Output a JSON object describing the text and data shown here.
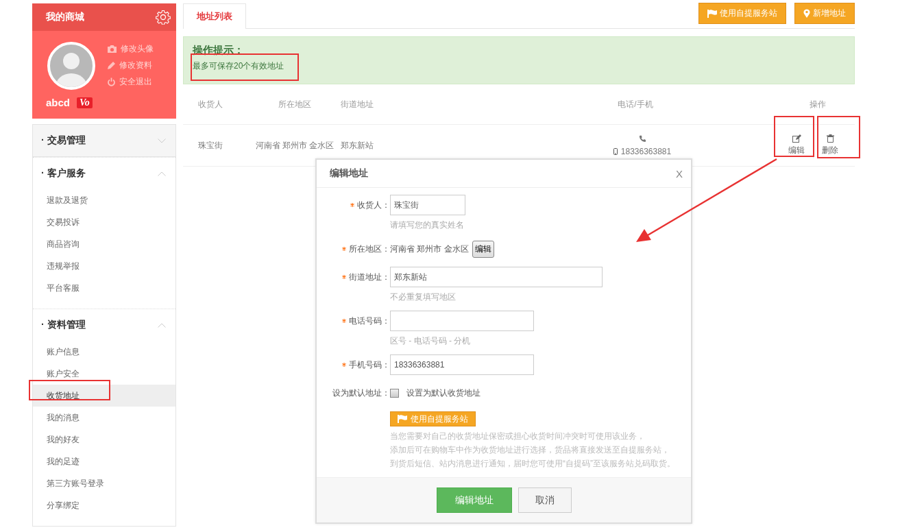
{
  "sidebar": {
    "title": "我的商城",
    "profile_links": [
      {
        "kind": "camera",
        "label": "修改头像"
      },
      {
        "kind": "pencil",
        "label": "修改资料"
      },
      {
        "kind": "power",
        "label": "安全退出"
      }
    ],
    "username": "abcd",
    "badge": "Vo",
    "groups": [
      {
        "title": "· 交易管理",
        "expanded": false
      },
      {
        "title": "· 客户服务",
        "expanded": true,
        "items": [
          {
            "label": "退款及退货",
            "selected": false
          },
          {
            "label": "交易投诉",
            "selected": false
          },
          {
            "label": "商品咨询",
            "selected": false
          },
          {
            "label": "违规举报",
            "selected": false
          },
          {
            "label": "平台客服",
            "selected": false
          }
        ]
      },
      {
        "title": "· 资料管理",
        "expanded": true,
        "items": [
          {
            "label": "账户信息",
            "selected": false
          },
          {
            "label": "账户安全",
            "selected": false
          },
          {
            "label": "收货地址",
            "selected": true
          },
          {
            "label": "我的消息",
            "selected": false
          },
          {
            "label": "我的好友",
            "selected": false
          },
          {
            "label": "我的足迹",
            "selected": false
          },
          {
            "label": "第三方账号登录",
            "selected": false
          },
          {
            "label": "分享绑定",
            "selected": false
          }
        ]
      }
    ]
  },
  "tabs": [
    {
      "label": "地址列表",
      "selected": true
    }
  ],
  "toolbar_buttons": [
    {
      "kind": "flag",
      "label": "使用自提服务站"
    },
    {
      "kind": "pin",
      "label": "新增地址"
    }
  ],
  "notice": {
    "title": "操作提示：",
    "text": "最多可保存20个有效地址"
  },
  "table": {
    "columns": [
      "收货人",
      "所在地区",
      "街道地址",
      "电话/手机",
      "操作"
    ],
    "rows": [
      {
        "name": "珠宝街",
        "region": "河南省 郑州市 金水区",
        "street": "郑东新站",
        "phone": "18336363881",
        "actions": [
          {
            "kind": "edit",
            "label": "编辑"
          },
          {
            "kind": "delete",
            "label": "删除"
          }
        ]
      }
    ]
  },
  "dialog": {
    "title": "编辑地址",
    "close": "X",
    "fields": [
      {
        "kind": "text",
        "required": true,
        "label": "收货人：",
        "value": "珠宝街",
        "hint": "请填写您的真实姓名"
      },
      {
        "kind": "region",
        "required": true,
        "label": "所在地区：",
        "value": "河南省 郑州市 金水区",
        "button": "编辑"
      },
      {
        "kind": "text",
        "required": true,
        "label": "街道地址：",
        "value": "郑东新站",
        "hint": "不必重复填写地区"
      },
      {
        "kind": "text",
        "required": true,
        "label": "电话号码：",
        "hint": "区号 - 电话号码 - 分机"
      },
      {
        "kind": "text",
        "required": true,
        "label": "手机号码：",
        "value": "18336363881"
      },
      {
        "kind": "checkbox",
        "required": false,
        "label": "设为默认地址：",
        "checked": false,
        "text": "设置为默认收货地址"
      }
    ],
    "pickup": {
      "button": "使用自提服务站",
      "description": [
        "当您需要对自己的收货地址保密或担心收货时间冲突时可使用该业务，",
        "添加后可在购物车中作为收货地址进行选择，货品将直接发送至自提服务站，",
        "到货后短信、站内消息进行通知，届时您可使用“自提码”至该服务站兑码取货。"
      ]
    },
    "buttons": [
      {
        "kind": "primary",
        "label": "编辑地址"
      },
      {
        "kind": "secondary",
        "label": "取消"
      }
    ]
  }
}
